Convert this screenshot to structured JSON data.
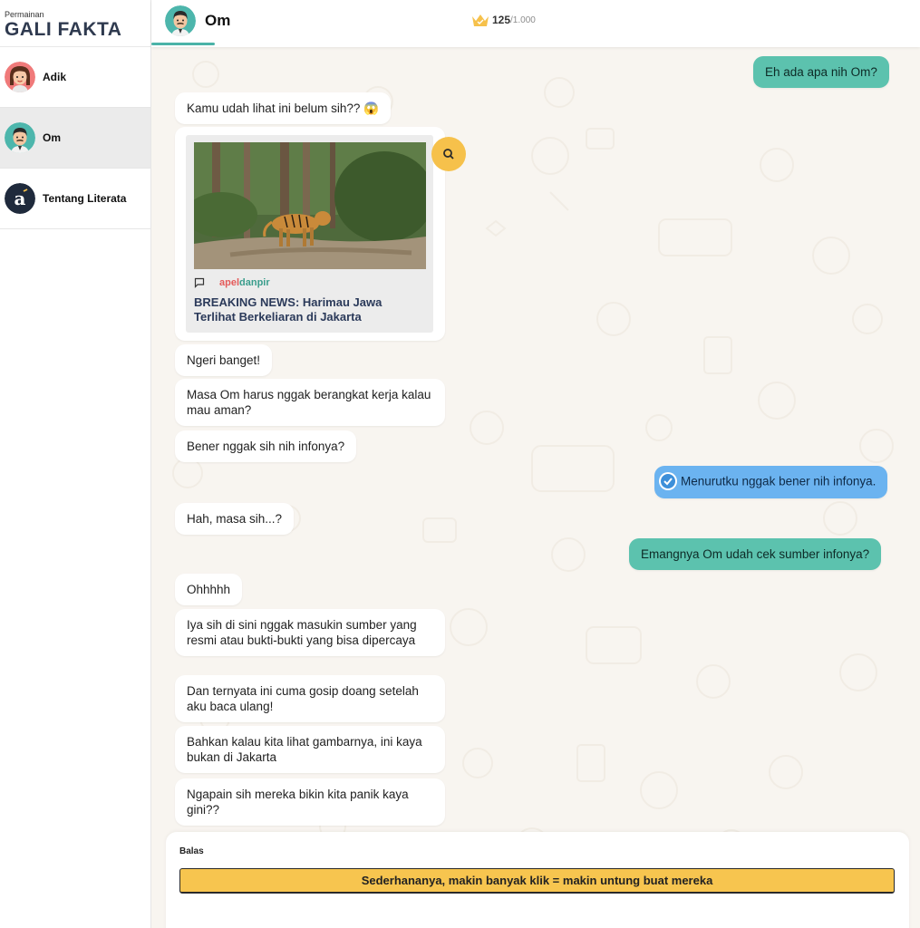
{
  "app": {
    "brand_small": "Permainan",
    "brand_title": "GALI FAKTA"
  },
  "sidebar": {
    "items": [
      {
        "label": "Adik",
        "icon": "adik-avatar",
        "active": false
      },
      {
        "label": "Om",
        "icon": "om-avatar",
        "active": true
      },
      {
        "label": "Tentang Literata",
        "icon": "literata-logo",
        "active": false
      }
    ]
  },
  "header": {
    "contact_name": "Om",
    "score": "125",
    "score_max": "/1.000",
    "score_icon": "crown-icon"
  },
  "messages": [
    {
      "dir": "out",
      "text": "Eh ada apa nih Om?"
    },
    {
      "dir": "in",
      "text": "Kamu udah lihat ini belum sih?? 😱"
    },
    {
      "dir": "in",
      "type": "news-card"
    },
    {
      "dir": "in",
      "text": "Ngeri banget!"
    },
    {
      "dir": "in",
      "text": "Masa Om harus nggak berangkat kerja kalau mau aman?"
    },
    {
      "dir": "in",
      "text": "Bener nggak sih nih infonya?"
    },
    {
      "dir": "out",
      "text": "Menurutku nggak bener nih infonya.",
      "checked": true
    },
    {
      "dir": "in",
      "text": "Hah, masa sih...?"
    },
    {
      "dir": "out",
      "text": "Emangnya Om udah cek sumber infonya?"
    },
    {
      "dir": "in",
      "text": "Ohhhhh"
    },
    {
      "dir": "in",
      "text": "Iya sih di sini nggak masukin sumber yang resmi atau bukti-bukti yang bisa dipercaya"
    },
    {
      "dir": "in",
      "text": "Dan ternyata ini cuma gosip doang setelah aku baca ulang!"
    },
    {
      "dir": "in",
      "text": "Bahkan kalau kita lihat gambarnya, ini kaya bukan di Jakarta"
    },
    {
      "dir": "in",
      "text": "Ngapain sih mereka bikin kita panik kaya gini??"
    }
  ],
  "news_card": {
    "source_a": "apel",
    "source_b": "danpir",
    "headline": "BREAKING NEWS: Harimau Jawa Terlihat Berkeliaran di Jakarta",
    "image": "tiger-in-forest",
    "colors": {
      "source_a": "#e45b5b",
      "source_b": "#3a9d8c"
    }
  },
  "reply": {
    "title": "Balas",
    "option": "Sederhananya, makin banyak klik = makin untung buat mereka"
  },
  "colors": {
    "out_bubble": "#5cc2ae",
    "checked_bubble": "#6bb3f0",
    "accent_yellow": "#f6c14b",
    "brand_navy": "#2f3a4f"
  }
}
